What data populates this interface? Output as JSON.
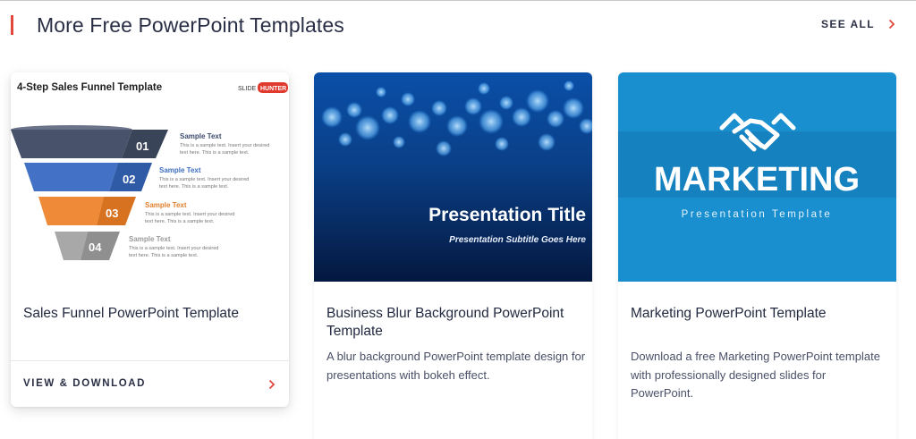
{
  "section": {
    "title": "More Free PowerPoint Templates",
    "see_all": "SEE ALL",
    "accent_color": "#e0483e"
  },
  "cards": [
    {
      "title": "Sales Funnel PowerPoint Template",
      "cta": "VIEW & DOWNLOAD",
      "thumb": {
        "heading": "4-Step Sales Funnel Template",
        "logo_text": "SLIDE",
        "logo_badge": "HUNTER",
        "steps": [
          {
            "num": "01",
            "label": "Sample Text",
            "desc1": "This is a sample text. Insert your desired",
            "desc2": "text here. This is a sample text."
          },
          {
            "num": "02",
            "label": "Sample Text",
            "desc1": "This is a sample text. Insert your desired",
            "desc2": "text here. This is a sample text."
          },
          {
            "num": "03",
            "label": "Sample Text",
            "desc1": "This is a sample text. Insert your desired",
            "desc2": "text here. This is a sample text."
          },
          {
            "num": "04",
            "label": "Sample Text",
            "desc1": "This is a sample text. Insert your desired",
            "desc2": "text here. This is a sample text."
          }
        ]
      }
    },
    {
      "title": "Business Blur Background PowerPoint Template",
      "description": "A blur background PowerPoint template design for presentations with bokeh effect.",
      "thumb": {
        "heading": "Presentation Title",
        "subheading": "Presentation Subtitle Goes Here"
      }
    },
    {
      "title": "Marketing PowerPoint Template",
      "description": "Download a free Marketing PowerPoint template with professionally designed slides for PowerPoint.",
      "thumb": {
        "heading": "MARKETING",
        "subheading": "Presentation Template",
        "icon": "handshake-icon"
      }
    }
  ]
}
